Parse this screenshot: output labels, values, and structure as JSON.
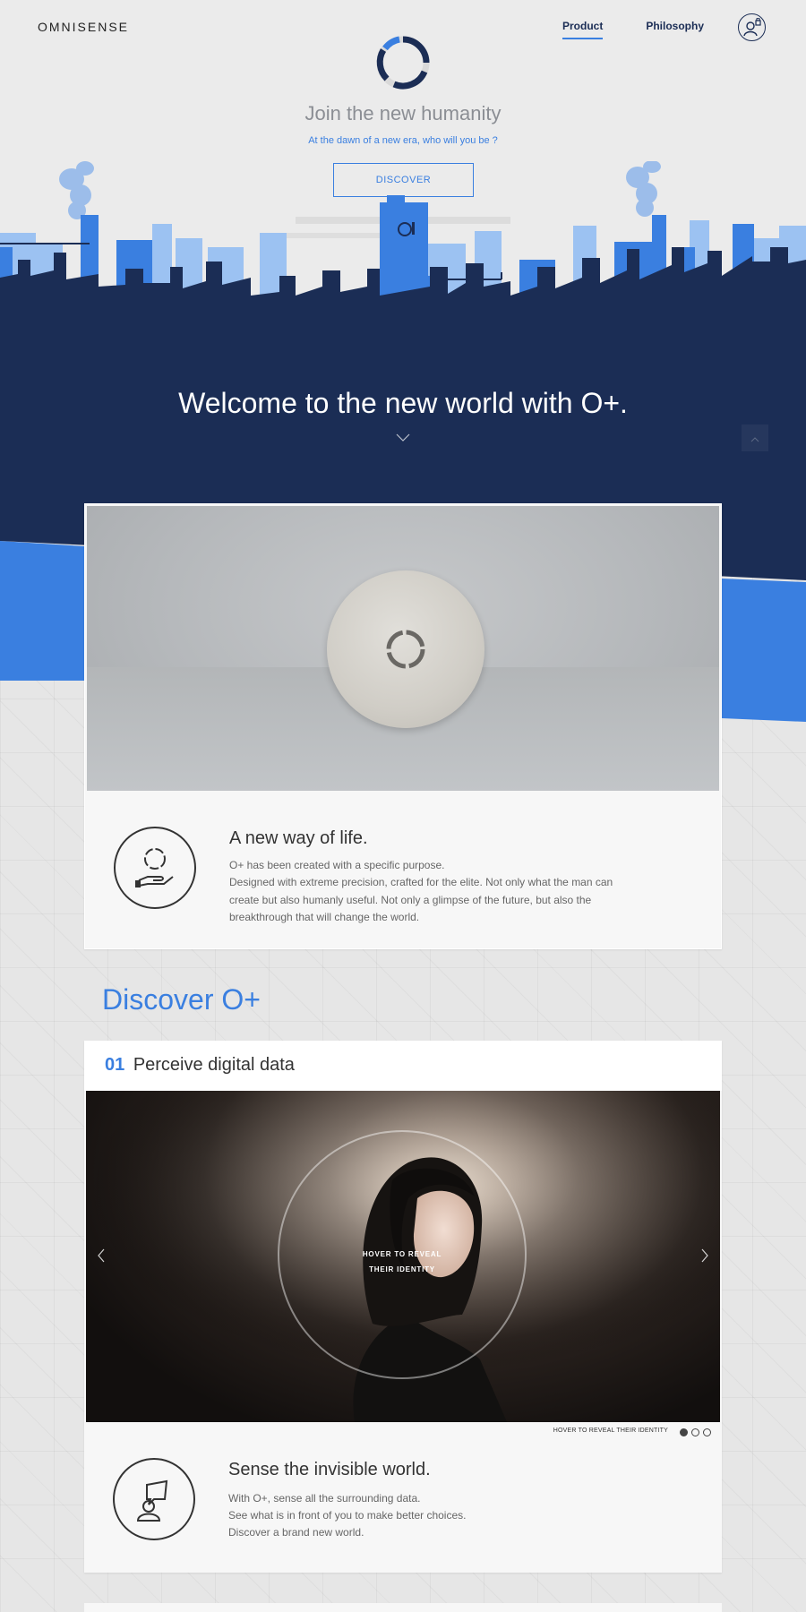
{
  "header": {
    "logo": "OMNISENSE",
    "nav": [
      {
        "label": "Product",
        "active": true
      },
      {
        "label": "Philosophy",
        "active": false
      }
    ],
    "user_icon": "user-lock-icon"
  },
  "hero": {
    "title": "Join the new humanity",
    "subtitle": "At the dawn of a new era, who will you be ?",
    "cta_label": "DISCOVER",
    "welcome": "Welcome to the new world with O+.",
    "scroll_icon": "chevron-down-icon",
    "top_icon": "chevron-up-icon"
  },
  "product": {
    "heading": "A new way of life.",
    "icon": "hand-holding-device-icon",
    "lines": [
      "O+ has been created with a specific purpose.",
      "Designed with extreme precision, crafted for the elite. Not only what the man can create but also humanly useful. Not only a glimpse of the future, but also the breakthrough that will change the world."
    ]
  },
  "discover": {
    "title": "Discover O+"
  },
  "feature": {
    "number": "01",
    "title": "Perceive digital data",
    "overlay_label": "HOVER TO REVEAL\nTHEIR IDENTITY",
    "pager_label": "HOVER TO REVEAL THEIR IDENTITY",
    "slides_total": 3,
    "slide_active": 1,
    "heading": "Sense the invisible world.",
    "icon": "person-data-icon",
    "lines": [
      "With O+, sense all the surrounding data.",
      "See what is in front of you to make better choices.",
      "Discover a brand new world."
    ]
  },
  "colors": {
    "accent": "#3a7fe0",
    "navy": "#1b2d55",
    "city_light": "#8fb8f0",
    "city_mid": "#3a7fe0",
    "background": "#e6e6e6"
  }
}
